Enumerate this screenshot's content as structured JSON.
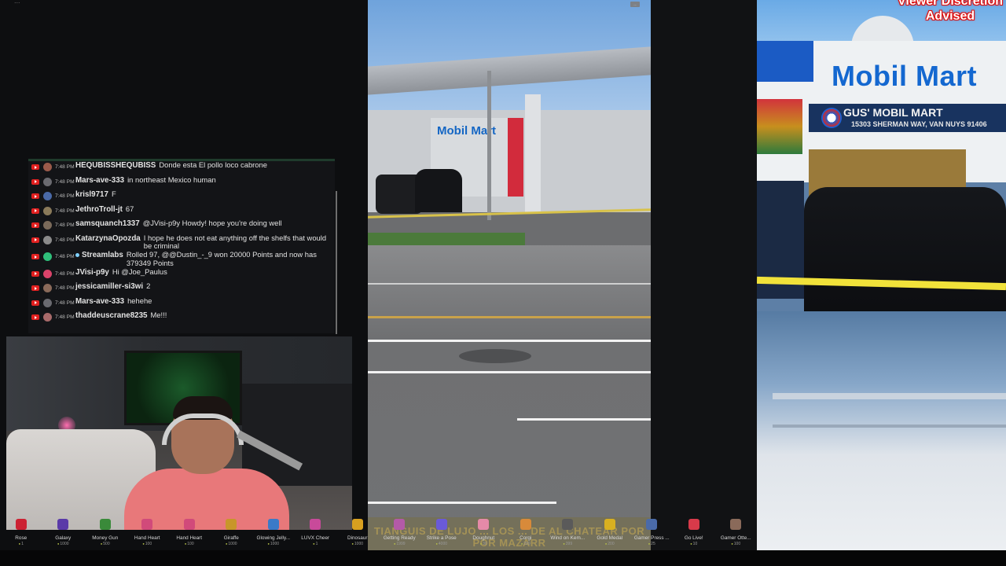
{
  "topbar": {
    "label": "..."
  },
  "chat": {
    "messages": [
      {
        "time": "7:48 PM",
        "user": "HEQUBISSHEQUBISS",
        "text": "Donde esta El pollo loco cabrone",
        "avatar_color": "#9a5a4a"
      },
      {
        "time": "7:48 PM",
        "user": "Mars-ave-333",
        "text": "in northeast Mexico human",
        "avatar_color": "#6a6a70"
      },
      {
        "time": "7:48 PM",
        "user": "krisl9717",
        "text": "F",
        "avatar_color": "#4a6aa8"
      },
      {
        "time": "7:48 PM",
        "user": "JethroTroll-jt",
        "text": "67",
        "avatar_color": "#8a7a5a"
      },
      {
        "time": "7:48 PM",
        "user": "samsquanch1337",
        "text": "@JVisi-p9y Howdy! hope you're doing well",
        "avatar_color": "#7a6a5a"
      },
      {
        "time": "7:48 PM",
        "user": "KatarzynaOpozda",
        "text": "I hope he does not eat anything off the shelfs that would be criminal",
        "avatar_color": "#8a8a8a"
      },
      {
        "time": "7:48 PM",
        "user": "Streamlabs",
        "text": "Rolled 97, @@Dustin_-_9 won 20000 Points and now has 379349 Points",
        "avatar_color": "#2fbf7a",
        "moderator": true
      },
      {
        "time": "7:48 PM",
        "user": "JVisi-p9y",
        "text": "Hi @Joe_Paulus",
        "avatar_color": "#d9436a"
      },
      {
        "time": "7:48 PM",
        "user": "jessicamiller-si3wi",
        "text": "2",
        "avatar_color": "#8a6a5a"
      },
      {
        "time": "7:48 PM",
        "user": "Mars-ave-333",
        "text": "hehehe",
        "avatar_color": "#6a6a70"
      },
      {
        "time": "7:48 PM",
        "user": "thaddeuscrane8235",
        "text": "Me!!!",
        "avatar_color": "#a86a6a"
      }
    ]
  },
  "video": {
    "store_sign": "Mobil Mart",
    "badge": "...",
    "caption": "TIANGUIS DE LUJO ... LOS ... DE AL CHATEAR POR POR MAZARR"
  },
  "right_panel": {
    "warning_line1": "Viewer Discretion",
    "warning_line2": "Advised",
    "store_name": "Mobil Mart",
    "store_subtitle": "GUS' MOBIL MART",
    "store_address": "15303 SHERMAN WAY, VAN NUYS 91406"
  },
  "rewards": [
    {
      "name": "Rose",
      "cost": "1",
      "icon": "rose-icon",
      "color": "#c23"
    },
    {
      "name": "Galaxy",
      "cost": "1000",
      "icon": "galaxy-icon",
      "color": "#5a3aa8"
    },
    {
      "name": "Money Gun",
      "cost": "500",
      "icon": "money-gun-icon",
      "color": "#3a8a3a"
    },
    {
      "name": "Hand Heart",
      "cost": "100",
      "icon": "hand-heart-icon",
      "color": "#d14a7a"
    },
    {
      "name": "Hand Heart",
      "cost": "100",
      "icon": "hand-heart-icon",
      "color": "#d14a7a"
    },
    {
      "name": "Giraffe",
      "cost": "1000",
      "icon": "giraffe-icon",
      "color": "#c8962a"
    },
    {
      "name": "Glowing Jelly...",
      "cost": "1000",
      "icon": "jellyfish-icon",
      "color": "#3a7ac8"
    },
    {
      "name": "LUVX Cheer",
      "cost": "1",
      "icon": "cheer-icon",
      "color": "#c84a9a"
    },
    {
      "name": "Dinosaur",
      "cost": "1000",
      "icon": "dinosaur-icon",
      "color": "#d8a020"
    },
    {
      "name": "Getting Ready",
      "cost": "1999",
      "icon": "getting-ready-icon",
      "color": "#b35aa8"
    },
    {
      "name": "Strike a Pose",
      "cost": "4000",
      "icon": "strike-pose-icon",
      "color": "#6a5ad8"
    },
    {
      "name": "Doughnut",
      "cost": "30",
      "icon": "doughnut-icon",
      "color": "#e58aa8"
    },
    {
      "name": "Corgi",
      "cost": "299",
      "icon": "corgi-icon",
      "color": "#d88a3a"
    },
    {
      "name": "Wind on Kem...",
      "cost": "399",
      "icon": "wind-icon",
      "color": "#5a5a5a"
    },
    {
      "name": "Gold Medal",
      "cost": "200",
      "icon": "gold-medal-icon",
      "color": "#d8b020"
    },
    {
      "name": "Gamer Press ...",
      "cost": "25",
      "icon": "gamer-icon",
      "color": "#4a6aa8"
    },
    {
      "name": "Go Live!",
      "cost": "10",
      "icon": "go-live-icon",
      "color": "#d83a4a"
    },
    {
      "name": "Gamer Otte...",
      "cost": "100",
      "icon": "gamer-otter-icon",
      "color": "#8a6a5a"
    }
  ]
}
